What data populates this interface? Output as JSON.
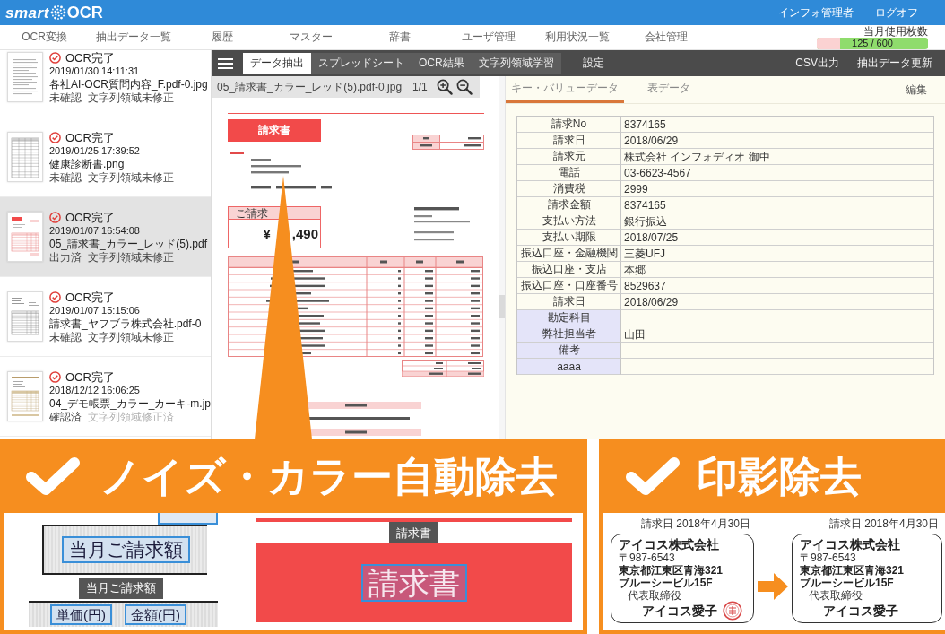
{
  "header": {
    "logo": "smart",
    "logo_mark": "OCR",
    "user": "インフォ管理者",
    "logout": "ログオフ"
  },
  "nav": {
    "items": [
      "OCR変換",
      "抽出データ一覧",
      "履歴",
      "マスター",
      "辞書",
      "ユーザ管理",
      "利用状況一覧",
      "会社管理"
    ],
    "usage": {
      "label": "当月使用枚数",
      "level": 0.21,
      "reading": "125 / 600"
    }
  },
  "sidebar": {
    "items": [
      {
        "thumbnail": {
          "kind": "text"
        },
        "status": "OCR完了",
        "time": "2019/01/30 14:11:31",
        "file": "各社AI-OCR質問内容_F.pdf-0.jpg",
        "review": "未確認",
        "region": "文字列領域未修正",
        "region_fixed": false,
        "selected": false
      },
      {
        "thumbnail": {
          "kind": "form"
        },
        "status": "OCR完了",
        "time": "2019/01/25 17:39:52",
        "file": "健康診断書.png",
        "review": "未確認",
        "region": "文字列領域未修正",
        "region_fixed": false,
        "selected": false
      },
      {
        "thumbnail": {
          "kind": "invoice-red"
        },
        "status": "OCR完了",
        "time": "2019/01/07 16:54:08",
        "file": "05_請求書_カラー_レッド(5).pdf",
        "review": "出力済",
        "region": "文字列領域未修正",
        "region_fixed": false,
        "selected": true
      },
      {
        "thumbnail": {
          "kind": "invoice"
        },
        "status": "OCR完了",
        "time": "2019/01/07 15:15:06",
        "file": "請求書_ヤフブラ株式会社.pdf-0",
        "review": "未確認",
        "region": "文字列領域未修正",
        "region_fixed": false,
        "selected": false
      },
      {
        "thumbnail": {
          "kind": "invoice-khaki"
        },
        "status": "OCR完了",
        "time": "2018/12/12 16:06:25",
        "file": "04_デモ帳票_カラー_カーキ-m.jp",
        "review": "確認済",
        "region": "文字列領域修正済",
        "region_fixed": true,
        "selected": false
      }
    ]
  },
  "toolbar": {
    "tabs": [
      {
        "label": "データ抽出",
        "selected": true
      },
      {
        "label": "スプレッドシート",
        "selected": false
      },
      {
        "label": "OCR結果",
        "selected": false
      },
      {
        "label": "文字列領域学習",
        "selected": false
      }
    ],
    "settings": "設定",
    "actions": [
      "CSV出力",
      "抽出データ更新"
    ]
  },
  "viewer": {
    "file": "05_請求書_カラー_レッド(5).pdf-0.jpg",
    "page": "1/1",
    "invoice": {
      "title": "請求書",
      "amount_label": "ご請求",
      "currency": "¥",
      "amount": ",490"
    }
  },
  "data_panel": {
    "tabs": [
      {
        "label": "キー・バリューデータ",
        "selected": true
      },
      {
        "label": "表データ",
        "selected": false
      }
    ],
    "edit": "編集",
    "rows": [
      {
        "kind": "extracted",
        "key": "請求No",
        "value": "8374165"
      },
      {
        "kind": "extracted",
        "key": "請求日",
        "value": "2018/06/29"
      },
      {
        "kind": "extracted",
        "key": "請求元",
        "value": "株式会社 インフォディオ 御中"
      },
      {
        "kind": "extracted",
        "key": "電話",
        "value": "03-6623-4567"
      },
      {
        "kind": "extracted",
        "key": "消費税",
        "value": "2999"
      },
      {
        "kind": "extracted",
        "key": "請求金額",
        "value": "8374165"
      },
      {
        "kind": "extracted",
        "key": "支払い方法",
        "value": "銀行振込"
      },
      {
        "kind": "extracted",
        "key": "支払い期限",
        "value": "2018/07/25"
      },
      {
        "kind": "extracted",
        "key": "振込口座・金融機関",
        "value": "三菱UFJ"
      },
      {
        "kind": "extracted",
        "key": "振込口座・支店",
        "value": "本郷"
      },
      {
        "kind": "extracted",
        "key": "振込口座・口座番号",
        "value": "8529637"
      },
      {
        "kind": "extracted",
        "key": "請求日",
        "value": "2018/06/29"
      },
      {
        "kind": "custom",
        "key": "勘定科目"
      },
      {
        "kind": "custom",
        "key": "弊社担当者",
        "value": "山田"
      },
      {
        "kind": "custom",
        "key": "備考"
      },
      {
        "kind": "custom",
        "key": "aaaa"
      }
    ]
  },
  "banners": [
    {
      "kind": "noise",
      "title": "ノイズ・カラー自動除去",
      "cell_label": "当月ご請求額",
      "cell_tooltip": "当月ご請求額",
      "column_labels": [
        "単価(円)",
        "金額(円)"
      ],
      "title_tooltip": "請求書",
      "title_label": "請求書"
    },
    {
      "kind": "stamp",
      "title": "印影除去",
      "cards": [
        {
          "date": "請求日 2018年4月30日",
          "company": "アイコス株式会社",
          "postal": "〒987-6543",
          "address": "東京都江東区青海321 ブルーシービル15F",
          "role": "代表取締役",
          "name": "アイコス愛子",
          "stamp": true
        },
        {
          "date": "請求日 2018年4月30日",
          "company": "アイコス株式会社",
          "postal": "〒987-6543",
          "address": "東京都江東区青海321 ブルーシービル15F",
          "role": "代表取締役",
          "name": "アイコス愛子",
          "stamp": false
        }
      ]
    }
  ]
}
